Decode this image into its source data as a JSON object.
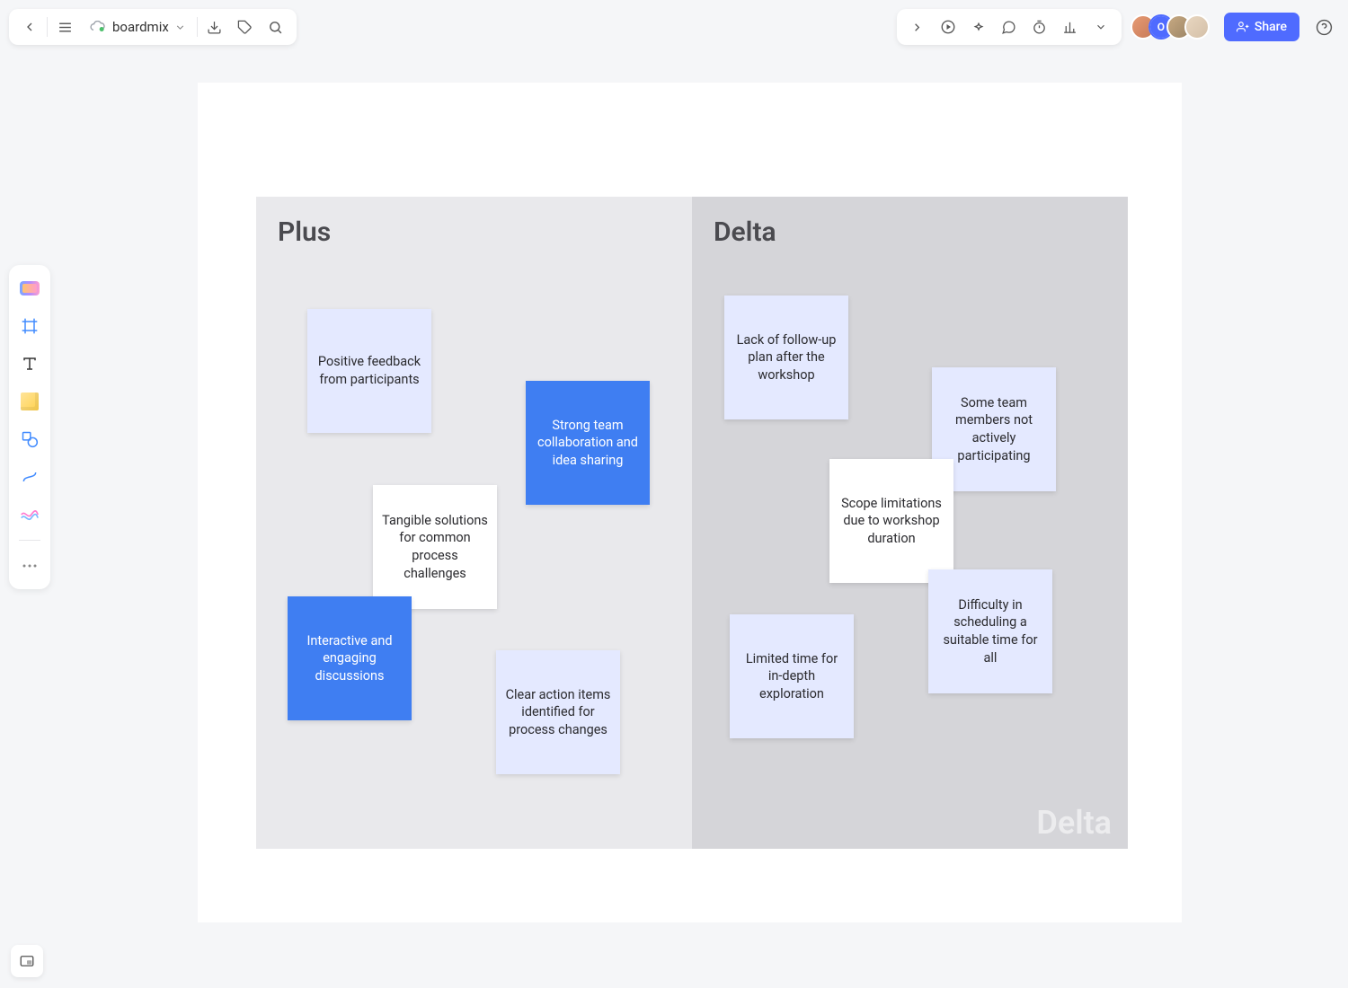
{
  "header": {
    "doc_name": "boardmix",
    "share_label": "Share",
    "avatar2_initial": "O"
  },
  "board": {
    "columns": {
      "plus": {
        "title": "Plus"
      },
      "delta": {
        "title": "Delta",
        "watermark": "Delta"
      }
    },
    "stickies": {
      "p1": "Positive feedback from participants",
      "p2": "Strong team collaboration and idea sharing",
      "p3": "Tangible solutions for common process challenges",
      "p4": "Interactive and engaging discussions",
      "p5": "Clear action items identified for process changes",
      "d1": "Lack of follow-up plan after the workshop",
      "d2": "Some team members not actively participating",
      "d3": "Scope limitations due to workshop duration",
      "d4": "Limited time for in-depth exploration",
      "d5": "Difficulty in scheduling a suitable time for all"
    }
  }
}
